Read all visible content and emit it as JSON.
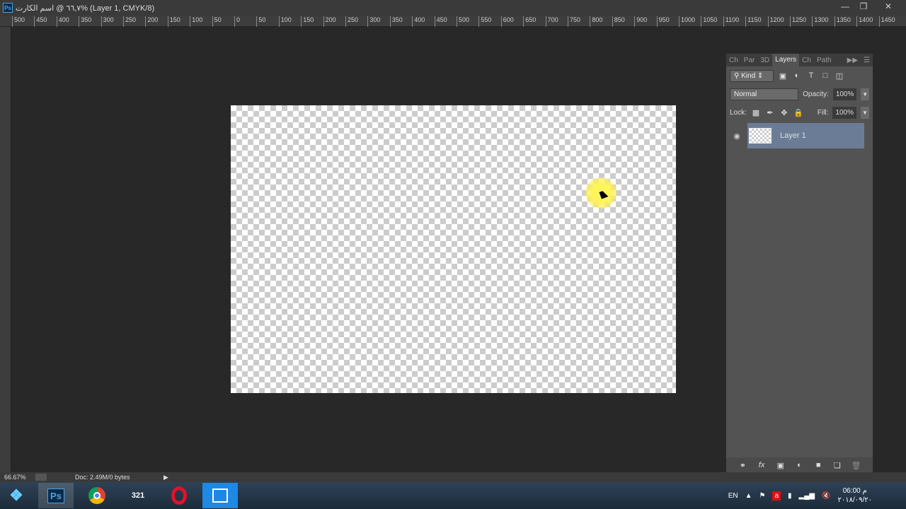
{
  "window": {
    "title": "٦٦,٧ @ اسم الكارت% (Layer 1, CMYK/8)",
    "app_icon": "Ps",
    "controls": [
      "minimize",
      "restore",
      "close"
    ]
  },
  "ruler": {
    "top_labels": [
      "500",
      "450",
      "400",
      "350",
      "300",
      "250",
      "200",
      "150",
      "100",
      "50",
      "0",
      "50",
      "100",
      "150",
      "200",
      "250",
      "300",
      "350",
      "400",
      "450",
      "500",
      "550",
      "600",
      "650",
      "700",
      "750",
      "800",
      "850",
      "900",
      "950",
      "1000",
      "1050",
      "1100",
      "1150",
      "1200",
      "1250",
      "1300",
      "1350",
      "1400",
      "1450"
    ],
    "unit": "px"
  },
  "layers_panel": {
    "tabs": [
      {
        "label": "Ch"
      },
      {
        "label": "Par"
      },
      {
        "label": "3D"
      },
      {
        "label": "Layers",
        "active": true
      },
      {
        "label": "Ch"
      },
      {
        "label": "Path"
      }
    ],
    "filter": "Kind",
    "blend_mode": "Normal",
    "opacity_label": "Opacity:",
    "opacity": "100%",
    "lock_label": "Lock:",
    "fill_label": "Fill:",
    "fill": "100%",
    "layers": [
      {
        "name": "Layer 1",
        "visible": true,
        "selected": true
      }
    ],
    "selected_color": "#6b7d96"
  },
  "status": {
    "zoom": "66.67%",
    "doc": "Doc: 2.49M/0 bytes"
  },
  "taskbar": {
    "apps": [
      "start",
      "Photoshop",
      "Chrome",
      "321 Player",
      "Opera",
      "Screen Capture"
    ],
    "tray": {
      "lang": "EN",
      "time": "06:00 م",
      "date": "٢٠١٨/٠٩/٢٠"
    }
  }
}
